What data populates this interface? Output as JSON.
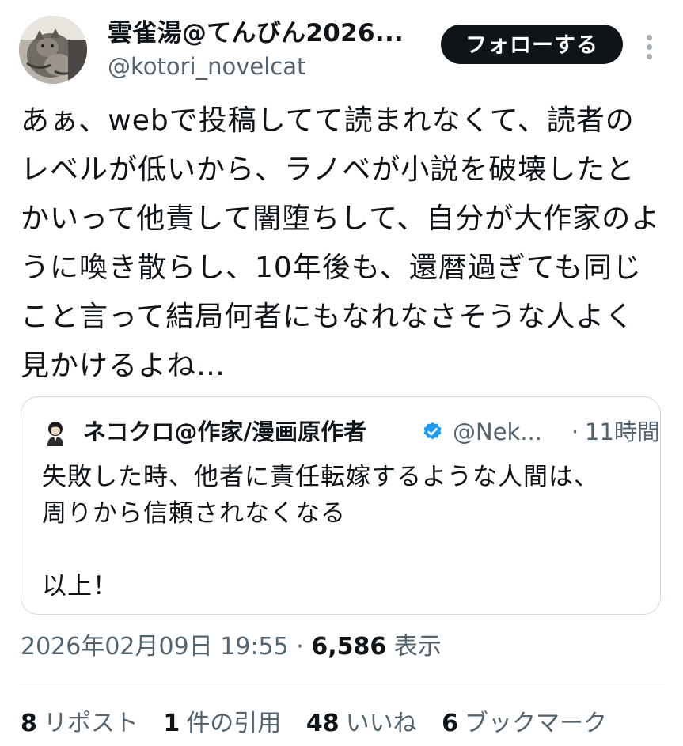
{
  "author": {
    "display_name": "雲雀湯@てんびん2026...",
    "handle": "@kotori_novelcat",
    "avatar_icon": "cat-photo-avatar"
  },
  "follow_button": {
    "label": "フォローする"
  },
  "more_menu": {
    "icon": "more-vertical-icon"
  },
  "tweet": {
    "text": "あぁ、webで投稿してて読まれなくて、読者のレベルが低いから、ラノベが小説を破壊したとかいって他責して闇堕ちして、自分が大作家のように喚き散らし、10年後も、還暦過ぎても同じこと言って結局何者にもなれなさそうな人よく見かけるよね…"
  },
  "quote": {
    "display_name": "ネコクロ@作家/漫画原作者",
    "handle": "@Nek...",
    "separator": "·",
    "time": "11時間",
    "text": "失敗した時、他者に責任転嫁するような人間は、\n周りから信頼されなくなる\n\n以上！",
    "verified_color": "#1d9bf0"
  },
  "meta": {
    "datetime": "2026年02月09日 19:55",
    "separator": "·",
    "views_count": "6,586",
    "views_label": "表示"
  },
  "stats": [
    {
      "count": "8",
      "label": "リポスト"
    },
    {
      "count": "1",
      "label": "件の引用"
    },
    {
      "count": "48",
      "label": "いいね"
    },
    {
      "count": "6",
      "label": "ブックマーク"
    }
  ],
  "colors": {
    "text": "#0f1419",
    "secondary": "#536471",
    "border": "#cfd9de",
    "follow_bg": "#0f1419"
  }
}
